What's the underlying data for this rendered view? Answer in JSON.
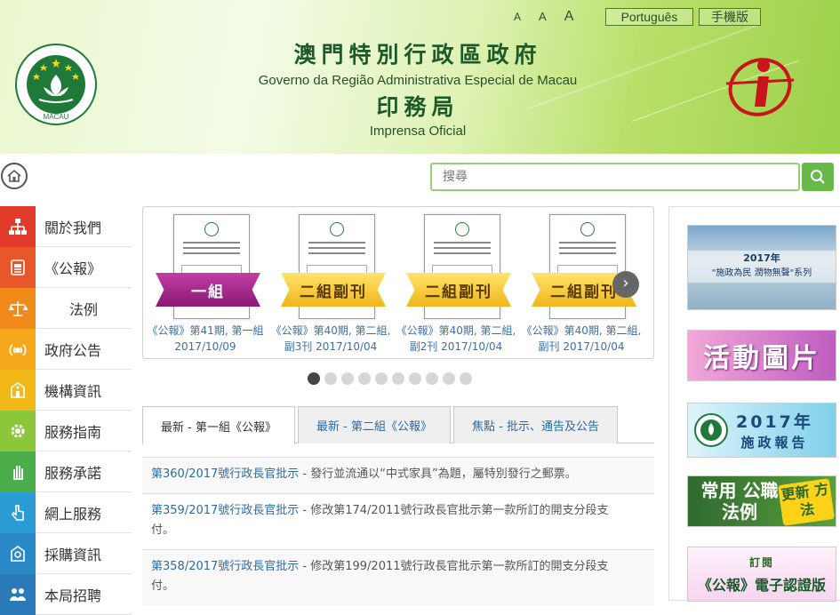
{
  "header": {
    "title_zh": "澳門特別行政區政府",
    "title_pt": "Governo da Região Administrativa Especial de Macau",
    "dept_zh": "印務局",
    "dept_pt": "Imprensa Oficial",
    "font_sizes": [
      "A",
      "A",
      "A"
    ],
    "lang_button": "Português",
    "mobile_button": "手機版",
    "emblem_text": "MACAU"
  },
  "search": {
    "placeholder": "搜尋"
  },
  "sidebar": {
    "items": [
      {
        "label": "關於我們",
        "icon": "org-chart-icon",
        "color": "#e23a2a"
      },
      {
        "label": "《公報》",
        "icon": "gazette-icon",
        "color": "#e8562a"
      },
      {
        "label": "法例",
        "icon": "scales-icon",
        "color": "#f08a1a"
      },
      {
        "label": "政府公告",
        "icon": "broadcast-icon",
        "color": "#f5a81a"
      },
      {
        "label": "機構資訊",
        "icon": "building-icon",
        "color": "#f2b81a"
      },
      {
        "label": "服務指南",
        "icon": "gear-icon",
        "color": "#8cc63a"
      },
      {
        "label": "服務承諾",
        "icon": "hand-icon",
        "color": "#4cae4a"
      },
      {
        "label": "網上服務",
        "icon": "pointer-hand-icon",
        "color": "#2a9bd4"
      },
      {
        "label": "採購資訊",
        "icon": "cart-icon",
        "color": "#2a8ac8"
      },
      {
        "label": "本局招聘",
        "icon": "people-icon",
        "color": "#2a7ab8"
      }
    ]
  },
  "carousel": {
    "slides": [
      {
        "ribbon": "一組",
        "style": "purple",
        "caption": "《公報》第41期, 第一組 2017/10/09"
      },
      {
        "ribbon": "二組副刊",
        "style": "gold",
        "caption": "《公報》第40期, 第二組, 副3刊 2017/10/04"
      },
      {
        "ribbon": "二組副刊",
        "style": "gold",
        "caption": "《公報》第40期, 第二組, 副2刊 2017/10/04"
      },
      {
        "ribbon": "二組副刊",
        "style": "gold",
        "caption": "《公報》第40期, 第二組, 副刊 2017/10/04"
      }
    ],
    "next_glyph": "›",
    "dot_count": 10,
    "active_dot": 0
  },
  "tabs": [
    {
      "label": "最新 - 第一組《公報》",
      "active": true
    },
    {
      "label": "最新 - 第二組《公報》",
      "active": false
    },
    {
      "label": "焦點 - 批示、通告及公告",
      "active": false
    }
  ],
  "news": [
    {
      "link": "第360/2017號行政長官批示",
      "text": " - 發行並流通以“中式家具”為題，屬特別發行之郵票。"
    },
    {
      "link": "第359/2017號行政長官批示",
      "text": " - 修改第174/2011號行政長官批示第一款所訂的開支分段支付。"
    },
    {
      "link": "第358/2017號行政長官批示",
      "text": " - 修改第199/2011號行政長官批示第一款所訂的開支分段支付。"
    }
  ],
  "banners": {
    "b1_title": "2017年",
    "b1_sub": "\"施政為民 潤物無聲\"系列",
    "b2": "活動圖片",
    "b3_l1": "2017年",
    "b3_l2": "施政報告",
    "b4_title": "常用 公職法例",
    "b4_tag": "更新 方法",
    "b5_l1": "訂閱",
    "b5_l2": "《公報》電子認證版"
  },
  "colors": {
    "accent_green": "#68b84a",
    "link_blue": "#2a6aa8"
  }
}
